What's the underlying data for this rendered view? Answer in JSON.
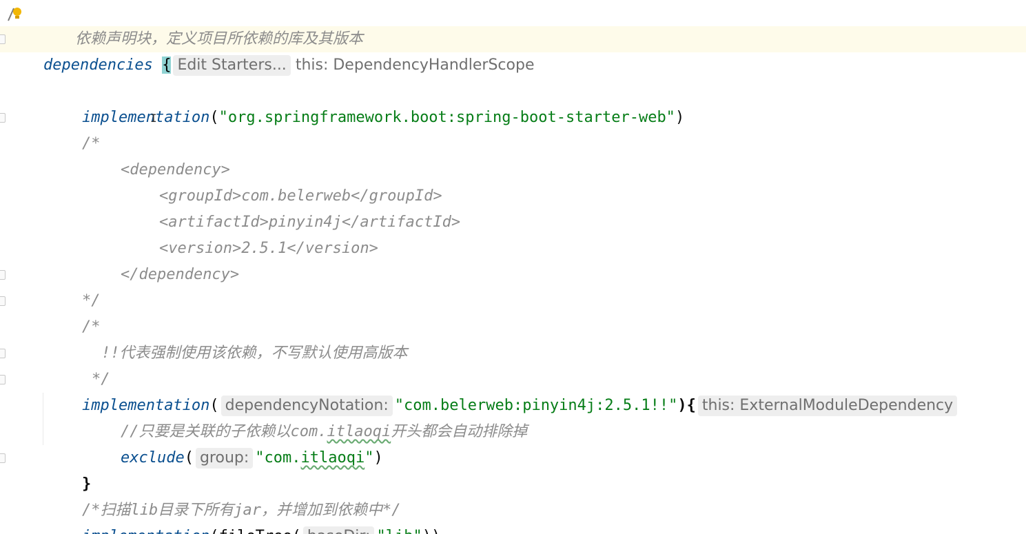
{
  "editor": {
    "line1_comment": "依赖声明块，定义项目所依赖的库及其版本",
    "dependencies_kw": "dependencies",
    "open_brace": "{",
    "hint_edit_starters": "Edit Starters...",
    "hint_this_scope": "this: DependencyHandlerScope",
    "impl1_method": "implementation",
    "impl1_open": "(",
    "impl1_arg": "\"org.springframework.boot:spring-boot-starter-web\"",
    "impl1_close": ")",
    "cmt_open": "/*",
    "xml_dep_open": "<dependency>",
    "xml_group": "<groupId>com.belerweb</groupId>",
    "xml_artifact": "<artifactId>pinyin4j</artifactId>",
    "xml_version": "<version>2.5.1</version>",
    "xml_dep_close": "</dependency>",
    "cmt_close": "*/",
    "cmt2_open": "/*",
    "cmt2_text": "!!代表强制使用该依赖，不写默认使用高版本",
    "cmt2_close": "*/",
    "impl2_method": "implementation",
    "impl2_open": "(",
    "hint_dependency_notation": "dependencyNotation:",
    "impl2_arg": "\"com.belerweb:pinyin4j:2.5.1!!\"",
    "impl2_close_brace": "){",
    "hint_this_external": "this: ExternalModuleDependency",
    "line_comment_prefix": "//只要是关联的子依赖以com.",
    "line_comment_squiggle": "itlaoqi",
    "line_comment_suffix": "开头都会自动排除掉",
    "exclude_method": "exclude",
    "exclude_open": "(",
    "hint_group": "group:",
    "exclude_arg_prefix": "\"com.",
    "exclude_arg_squiggle": "itlaoqi",
    "exclude_arg_suffix": "\"",
    "exclude_close": ")",
    "close_brace_inner": "}",
    "cmt3": "/*扫描lib目录下所有jar，并增加到依赖中*/",
    "impl3_method": "implementation",
    "impl3_open": "(",
    "impl3_filetree": "fileTree(",
    "hint_basedir": "baseDir:",
    "impl3_arg": "\"lib\"",
    "impl3_close": "))"
  },
  "icons": {
    "bulb": "lightbulb-edit-icon",
    "caret": "text-cursor-icon"
  },
  "colors": {
    "keyword": "#0a4f8f",
    "string": "#067d17",
    "comment": "#8c8c8c",
    "brace_highlight": "#8fd3d3",
    "current_line": "#fefbea"
  }
}
